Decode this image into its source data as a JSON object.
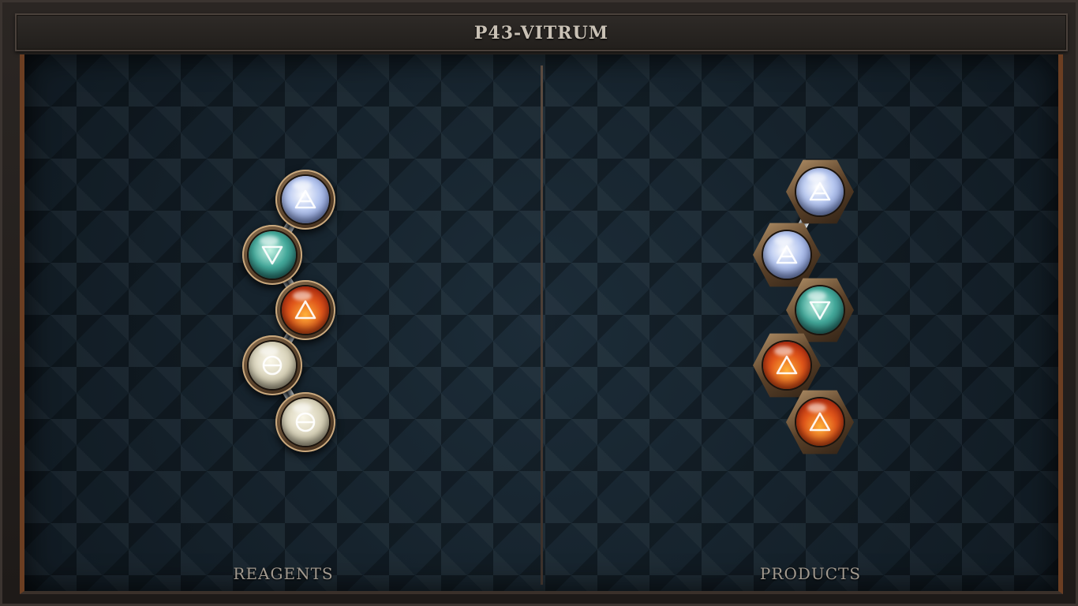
{
  "title": "P43-VITRUM",
  "panels": {
    "reagents_label": "REAGENTS",
    "products_label": "PRODUCTS"
  },
  "reagents": {
    "atoms": [
      {
        "element": "air",
        "icon": "air-triangle-icon"
      },
      {
        "element": "water",
        "icon": "water-triangle-icon"
      },
      {
        "element": "fire",
        "icon": "fire-triangle-icon"
      },
      {
        "element": "salt",
        "icon": "salt-theta-icon"
      },
      {
        "element": "salt",
        "icon": "salt-theta-icon"
      }
    ]
  },
  "products": {
    "atoms": [
      {
        "element": "air",
        "icon": "air-triangle-icon"
      },
      {
        "element": "air",
        "icon": "air-triangle-icon"
      },
      {
        "element": "water",
        "icon": "water-triangle-icon"
      },
      {
        "element": "fire",
        "icon": "fire-triangle-icon"
      },
      {
        "element": "fire",
        "icon": "fire-triangle-icon"
      }
    ]
  },
  "colors": {
    "air": "#b9c9f0",
    "water": "#43a89a",
    "fire": "#e0561a",
    "salt": "#d7d1b8",
    "frame_accent": "#6b3e22"
  }
}
